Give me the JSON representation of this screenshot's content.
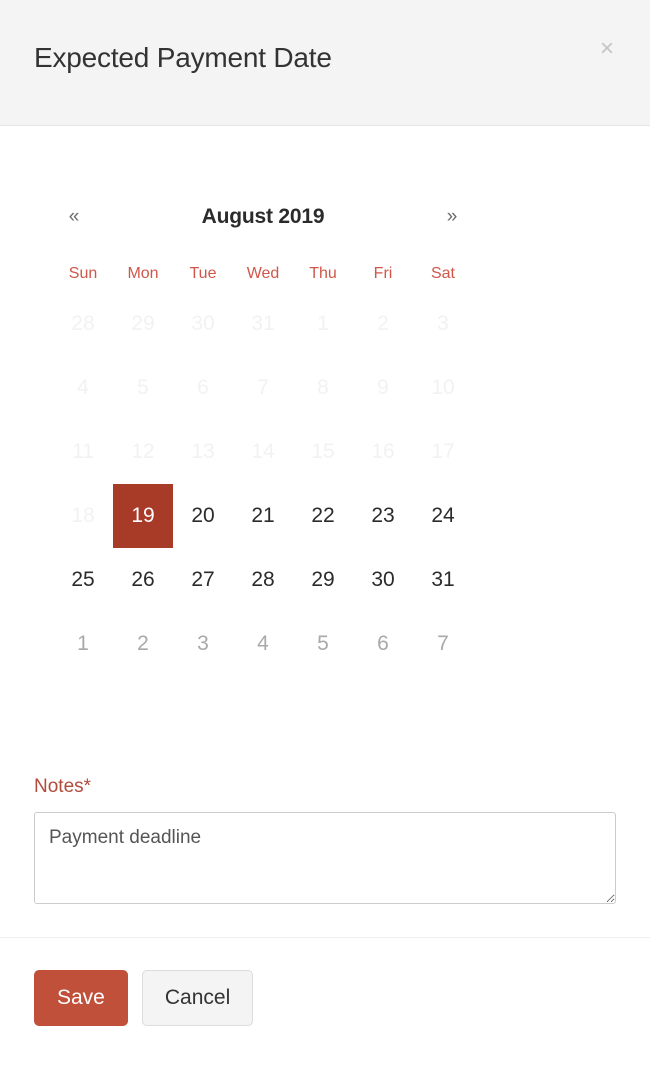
{
  "header": {
    "title": "Expected Payment Date",
    "close_icon": "close-icon",
    "close_glyph": "×"
  },
  "calendar": {
    "prev_glyph": "«",
    "next_glyph": "»",
    "month_label": "August 2019",
    "month": "August",
    "year": "2019",
    "weekdays": [
      "Sun",
      "Mon",
      "Tue",
      "Wed",
      "Thu",
      "Fri",
      "Sat"
    ],
    "selected_day": "19",
    "weekday_color": "#d0564a",
    "selected_color": "#a83a28",
    "weeks": [
      [
        {
          "label": "28",
          "state": "muted"
        },
        {
          "label": "29",
          "state": "muted"
        },
        {
          "label": "30",
          "state": "muted"
        },
        {
          "label": "31",
          "state": "muted"
        },
        {
          "label": "1",
          "state": "muted"
        },
        {
          "label": "2",
          "state": "muted"
        },
        {
          "label": "3",
          "state": "muted"
        }
      ],
      [
        {
          "label": "4",
          "state": "muted"
        },
        {
          "label": "5",
          "state": "muted"
        },
        {
          "label": "6",
          "state": "muted"
        },
        {
          "label": "7",
          "state": "muted"
        },
        {
          "label": "8",
          "state": "muted"
        },
        {
          "label": "9",
          "state": "muted"
        },
        {
          "label": "10",
          "state": "muted"
        }
      ],
      [
        {
          "label": "11",
          "state": "muted"
        },
        {
          "label": "12",
          "state": "muted"
        },
        {
          "label": "13",
          "state": "muted"
        },
        {
          "label": "14",
          "state": "muted"
        },
        {
          "label": "15",
          "state": "muted"
        },
        {
          "label": "16",
          "state": "muted"
        },
        {
          "label": "17",
          "state": "muted"
        }
      ],
      [
        {
          "label": "18",
          "state": "muted"
        },
        {
          "label": "19",
          "state": "selected"
        },
        {
          "label": "20",
          "state": "active"
        },
        {
          "label": "21",
          "state": "active"
        },
        {
          "label": "22",
          "state": "active"
        },
        {
          "label": "23",
          "state": "active"
        },
        {
          "label": "24",
          "state": "active"
        }
      ],
      [
        {
          "label": "25",
          "state": "active"
        },
        {
          "label": "26",
          "state": "active"
        },
        {
          "label": "27",
          "state": "active"
        },
        {
          "label": "28",
          "state": "active"
        },
        {
          "label": "29",
          "state": "active"
        },
        {
          "label": "30",
          "state": "active"
        },
        {
          "label": "31",
          "state": "active"
        }
      ],
      [
        {
          "label": "1",
          "state": "next"
        },
        {
          "label": "2",
          "state": "next"
        },
        {
          "label": "3",
          "state": "next"
        },
        {
          "label": "4",
          "state": "next"
        },
        {
          "label": "5",
          "state": "next"
        },
        {
          "label": "6",
          "state": "next"
        },
        {
          "label": "7",
          "state": "next"
        }
      ]
    ]
  },
  "notes": {
    "label": "Notes*",
    "value": "Payment deadline",
    "placeholder": ""
  },
  "footer": {
    "save_label": "Save",
    "cancel_label": "Cancel",
    "save_color": "#c0503a"
  }
}
